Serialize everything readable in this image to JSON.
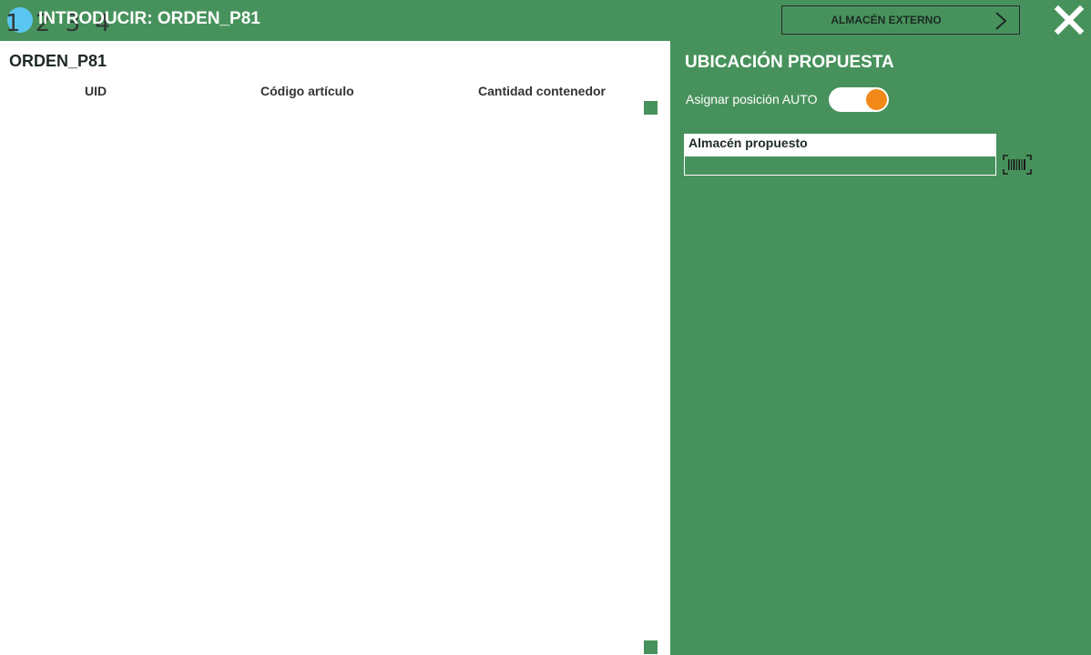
{
  "header": {
    "step_numbers": "1 2 3 4",
    "title": "INTRODUCIR: ORDEN_P81",
    "external_button_label": "ALMACÉN EXTERNO"
  },
  "left_panel": {
    "order_title": "ORDEN_P81",
    "columns": [
      "UID",
      "Código artículo",
      "Cantidad contenedor"
    ]
  },
  "right_panel": {
    "title": "UBICACIÓN PROPUESTA",
    "auto_label": "Asignar posición AUTO",
    "auto_enabled": true,
    "field_label": "Almacén propuesto",
    "field_value": ""
  },
  "colors": {
    "accent_green": "#47925c",
    "toggle_knob": "#f28a1a",
    "status_dot": "#5bc6f2"
  },
  "icons": {
    "status": "status-dot-icon",
    "chevron": "chevron-right-icon",
    "close": "close-icon",
    "barcode": "barcode-scan-icon"
  }
}
